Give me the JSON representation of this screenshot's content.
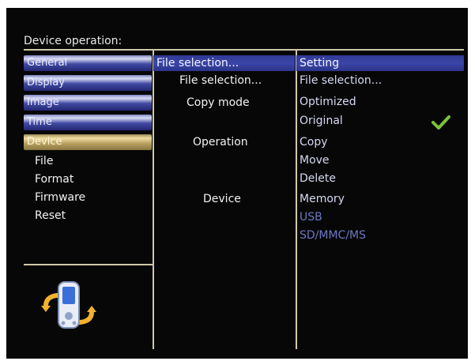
{
  "header": {
    "title": "Device operation:"
  },
  "sidebar": {
    "tabs": [
      {
        "label": "General"
      },
      {
        "label": "Display"
      },
      {
        "label": "Image"
      },
      {
        "label": "Time"
      },
      {
        "label": "Device"
      }
    ],
    "active_tab": "Device",
    "sub_items": [
      {
        "label": "File"
      },
      {
        "label": "Format"
      },
      {
        "label": "Firmware"
      },
      {
        "label": "Reset"
      }
    ]
  },
  "middle": {
    "header": "File selection...",
    "items": [
      {
        "label": "File selection..."
      },
      {
        "label": "Copy mode"
      },
      {
        "label": "Operation"
      },
      {
        "label": "Device"
      }
    ]
  },
  "right": {
    "header": "Setting",
    "options": [
      {
        "label": "File selection..."
      },
      {
        "label": "Optimized"
      },
      {
        "label": "Original",
        "checked": true
      },
      {
        "label": "Copy"
      },
      {
        "label": "Move"
      },
      {
        "label": "Delete"
      },
      {
        "label": "Memory"
      },
      {
        "label": "USB",
        "disabled": true
      },
      {
        "label": "SD/MMC/MS",
        "disabled": true
      }
    ]
  },
  "colors": {
    "background": "#070707",
    "divider": "#cfc7a8",
    "highlight": "#3b46a8",
    "active_tab": "#d6c28a",
    "checkmark": "#7cc23a",
    "disabled_text": "#6d78c4"
  },
  "icons": {
    "check": "checkmark-icon",
    "device": "device-rotate-icon"
  }
}
